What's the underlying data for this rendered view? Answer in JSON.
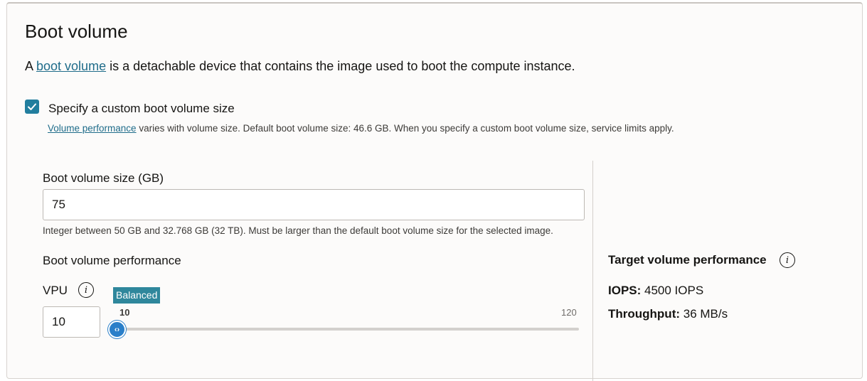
{
  "section": {
    "title": "Boot volume",
    "desc_prefix": "A ",
    "desc_link": "boot volume",
    "desc_suffix": " is a detachable device that contains the image used to boot the compute instance."
  },
  "custom_size": {
    "checked": true,
    "label": "Specify a custom boot volume size",
    "help_link": "Volume performance",
    "help_text": " varies with volume size. Default boot volume size: 46.6 GB. When you specify a custom boot volume size, service limits apply."
  },
  "size_field": {
    "label": "Boot volume size (GB)",
    "value": "75",
    "help": "Integer between 50 GB and 32.768 GB (32 TB). Must be larger than the default boot volume size for the selected image."
  },
  "performance": {
    "label": "Boot volume performance",
    "vpu_label": "VPU",
    "vpu_value": "10",
    "slider_badge": "Balanced",
    "slider_min": "10",
    "slider_max": "120",
    "slider_value": 10,
    "thumb_glyph": "‹›"
  },
  "target": {
    "title": "Target volume performance",
    "iops_label": "IOPS:",
    "iops_value": " 4500 IOPS",
    "throughput_label": "Throughput:",
    "throughput_value": " 36 MB/s"
  },
  "colors": {
    "accent": "#227e9e",
    "link": "#1f6c8a",
    "slider_thumb": "#2a7fc9",
    "badge": "#2f879c"
  },
  "icons": {
    "info": "info-icon",
    "check": "check-icon",
    "slider_thumb": "chevrons-left-right-icon"
  }
}
